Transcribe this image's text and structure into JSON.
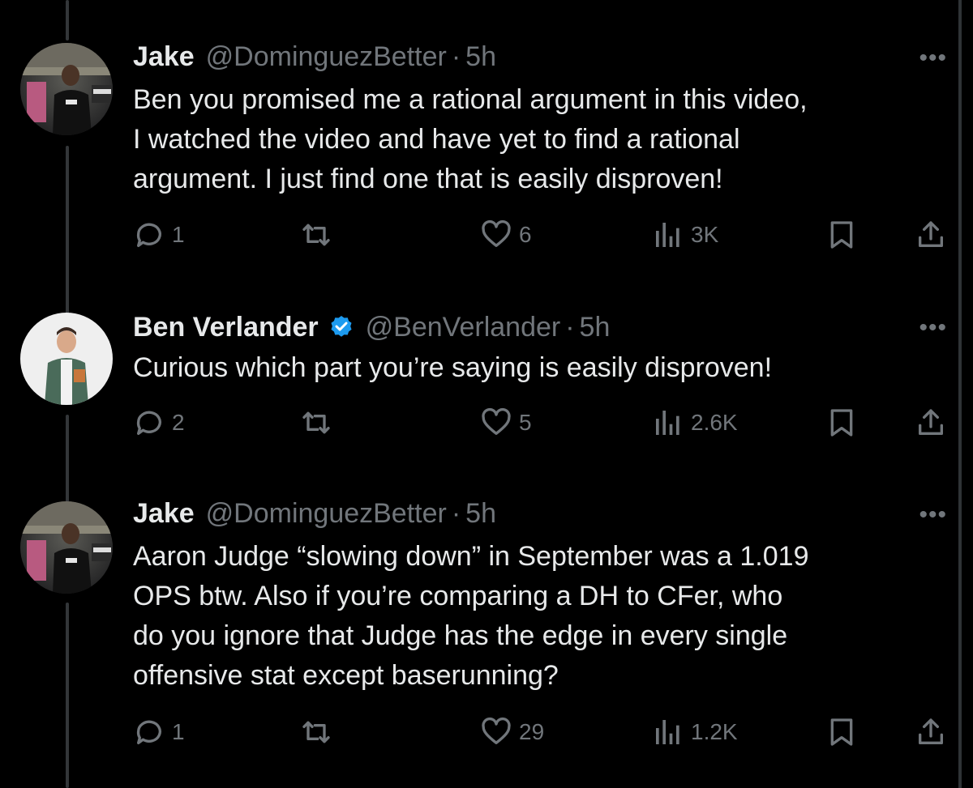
{
  "tweets": [
    {
      "name": "Jake",
      "handle": "@DominguezBetter",
      "dot": "·",
      "time": "5h",
      "verified": false,
      "avatar": "avatar-jake",
      "lines": [
        "Ben you promised me a rational argument in this video,",
        "I watched the video and have yet to find a rational",
        "argument. I just find one that is easily disproven!"
      ],
      "replies": "1",
      "reposts": "",
      "likes": "6",
      "views": "3K"
    },
    {
      "name": "Ben Verlander",
      "handle": "@BenVerlander",
      "dot": "·",
      "time": "5h",
      "verified": true,
      "avatar": "avatar-ben",
      "lines": [
        "Curious which part you’re saying is easily disproven!"
      ],
      "replies": "2",
      "reposts": "",
      "likes": "5",
      "views": "2.6K"
    },
    {
      "name": "Jake",
      "handle": "@DominguezBetter",
      "dot": "·",
      "time": "5h",
      "verified": false,
      "avatar": "avatar-jake",
      "lines": [
        "Aaron Judge “slowing down” in September was a 1.019",
        "OPS btw. Also if you’re comparing a DH to CFer, who",
        "do you ignore that Judge has the edge in every single",
        "offensive stat except baserunning?"
      ],
      "replies": "1",
      "reposts": "",
      "likes": "29",
      "views": "1.2K"
    }
  ],
  "more_label": "•••",
  "icons": {
    "reply": "reply-icon",
    "repost": "repost-icon",
    "like": "heart-icon",
    "views": "views-icon",
    "bookmark": "bookmark-icon",
    "share": "share-icon",
    "verified": "verified-badge-icon"
  },
  "colors": {
    "background": "#000000",
    "text": "#e7e9ea",
    "muted": "#71767b",
    "verified": "#1d9bf0"
  }
}
